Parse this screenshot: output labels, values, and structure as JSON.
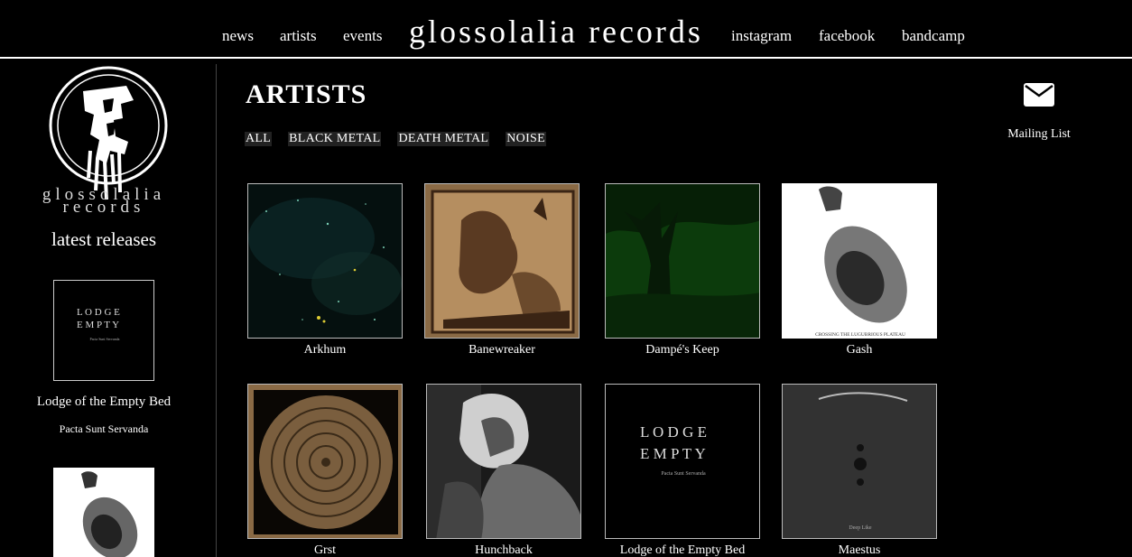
{
  "nav": {
    "news": "news",
    "artists": "artists",
    "events": "events",
    "brand": "glossolalia records",
    "instagram": "instagram",
    "facebook": "facebook",
    "bandcamp": "bandcamp"
  },
  "sidebar": {
    "logo_line1": "glossolalia",
    "logo_line2": "records",
    "latest_title": "latest releases",
    "releases": [
      {
        "artist": "Lodge of the Empty Bed",
        "title": "Pacta Sunt Servanda"
      },
      {
        "artist": "",
        "title": ""
      }
    ]
  },
  "main": {
    "title": "ARTISTS",
    "filters": [
      "ALL",
      "BLACK METAL",
      "DEATH METAL",
      "NOISE"
    ],
    "artists": [
      {
        "name": "Arkhum"
      },
      {
        "name": "Banewreaker"
      },
      {
        "name": "Dampé's Keep"
      },
      {
        "name": "Gash"
      },
      {
        "name": "Grst"
      },
      {
        "name": "Hunchback"
      },
      {
        "name": "Lodge of the Empty Bed"
      },
      {
        "name": "Maestus"
      }
    ]
  },
  "mailing": {
    "label": "Mailing List",
    "icon": "envelope-icon"
  },
  "covers": {
    "gash_caption": "CROSSING THE LUGUBRIOUS PLATEAU",
    "lodge_caption": "Pacta Sunt Servanda",
    "maestus_caption": "Deep Like"
  }
}
